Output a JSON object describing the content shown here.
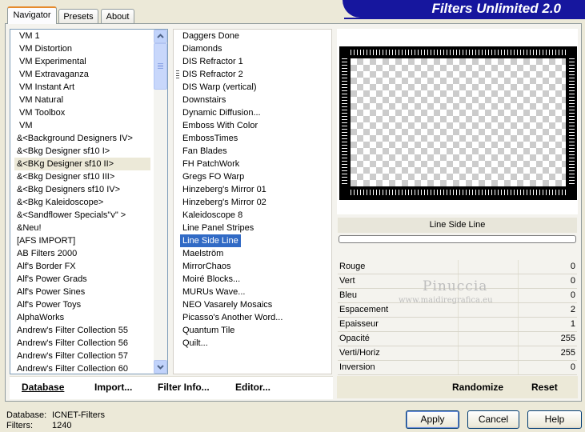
{
  "tabs": [
    {
      "label": "Navigator",
      "active": true
    },
    {
      "label": "Presets",
      "active": false
    },
    {
      "label": "About",
      "active": false
    }
  ],
  "banner_title": "Filters Unlimited 2.0",
  "categories": [
    "VM 1",
    "VM Distortion",
    "VM Experimental",
    "VM Extravaganza",
    "VM Instant Art",
    "VM Natural",
    "VM Toolbox",
    "VM",
    "&<Background Designers IV>",
    "&<Bkg Designer sf10 I>",
    "&<BKg Designer sf10 II>",
    "&<Bkg Designer sf10 III>",
    "&<Bkg Designers sf10 IV>",
    "&<Bkg Kaleidoscope>",
    "&<Sandflower Specials\"v\" >",
    "&Neu!",
    "[AFS IMPORT]",
    "AB Filters 2000",
    "Alf's Border FX",
    "Alf's Power Grads",
    "Alf's Power Sines",
    "Alf's Power Toys",
    "AlphaWorks",
    "Andrew's Filter Collection 55",
    "Andrew's Filter Collection 56",
    "Andrew's Filter Collection 57",
    "Andrew's Filter Collection 60"
  ],
  "selected_category": "&<BKg Designer sf10 II>",
  "filters": [
    "Daggers Done",
    "Diamonds",
    "DIS Refractor 1",
    "DIS Refractor 2",
    "DIS Warp (vertical)",
    "Downstairs",
    "Dynamic Diffusion...",
    "Emboss With Color",
    "EmbossTimes",
    "Fan Blades",
    "FH PatchWork",
    "Gregs FO Warp",
    "Hinzeberg's Mirror 01",
    "Hinzeberg's Mirror 02",
    "Kaleidoscope 8",
    "Line Panel Stripes",
    "Line Side Line",
    "Maelström",
    "MirrorChaos",
    "Moiré Blocks...",
    "MURUs Wave...",
    "NEO Vasarely Mosaics",
    "Picasso's Another Word...",
    "Quantum Tile",
    "Quilt..."
  ],
  "selected_filter": "Line Side Line",
  "filter_name": "Line Side Line",
  "params": [
    {
      "label": "Rouge",
      "value": "0"
    },
    {
      "label": "Vert",
      "value": "0"
    },
    {
      "label": "Bleu",
      "value": "0"
    },
    {
      "label": "Espacement",
      "value": "2"
    },
    {
      "label": "Epaisseur",
      "value": "1"
    },
    {
      "label": "Opacité",
      "value": "255"
    },
    {
      "label": "Verti/Horiz",
      "value": "255"
    },
    {
      "label": "Inversion",
      "value": "0"
    }
  ],
  "watermark": {
    "name": "Pinuccia",
    "url": "www.maidiregrafica.eu"
  },
  "links": {
    "database": "Database",
    "import": "Import...",
    "filter_info": "Filter Info...",
    "editor": "Editor...",
    "randomize": "Randomize",
    "reset": "Reset"
  },
  "status": {
    "database_label": "Database:",
    "database_value": "ICNET-Filters",
    "filters_label": "Filters:",
    "filters_value": "1240"
  },
  "buttons": {
    "apply": "Apply",
    "cancel": "Cancel",
    "help": "Help"
  },
  "icons": {
    "scroll_up": "chevron-up-icon",
    "scroll_down": "chevron-down-icon"
  }
}
